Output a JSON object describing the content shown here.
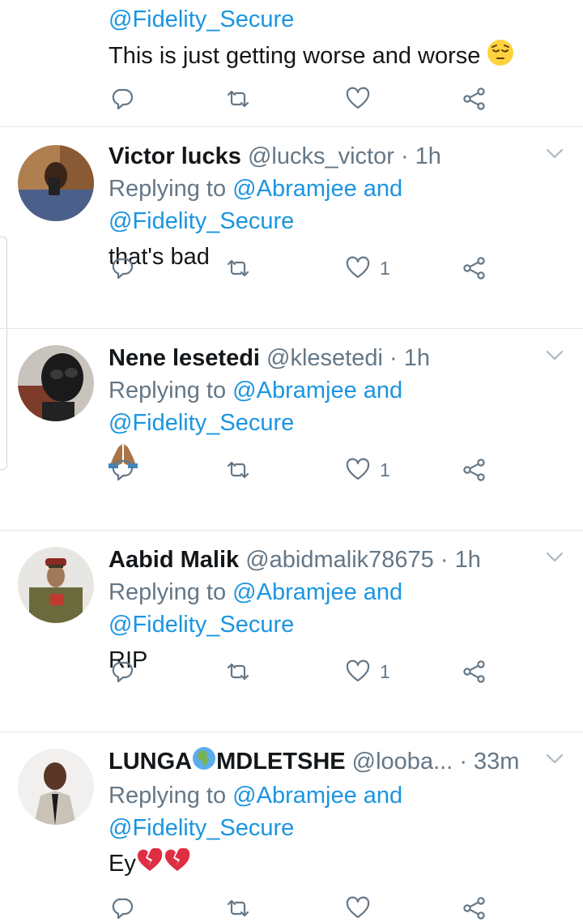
{
  "colors": {
    "accent": "#1b95e0",
    "text": "#14171a",
    "muted": "#657786",
    "divider": "#e1e8ed"
  },
  "first_tweet": {
    "mention": "@Fidelity_Secure",
    "text": "This is just getting worse and worse",
    "emoji": "pensive-face"
  },
  "replies": [
    {
      "name": "Victor lucks",
      "handle": "@lucks_victor",
      "time": "· 1h",
      "replying_prefix": "Replying to",
      "replying_mention1": "@Abramjee and",
      "replying_mention2": "@Fidelity_Secure",
      "text": "that's bad",
      "likes": "1"
    },
    {
      "name": "Nene lesetedi",
      "handle": "@klesetedi",
      "time": "· 1h",
      "replying_prefix": "Replying to",
      "replying_mention1": "@Abramjee and",
      "replying_mention2": "@Fidelity_Secure",
      "text": "",
      "emoji": "folded-hands",
      "likes": "1"
    },
    {
      "name": "Aabid Malik",
      "handle": "@abidmalik78675",
      "time": "· 1h",
      "replying_prefix": "Replying to",
      "replying_mention1": "@Abramjee and",
      "replying_mention2": "@Fidelity_Secure",
      "text": "RIP",
      "likes": "1"
    },
    {
      "name_part1": "LUNGA",
      "name_emoji": "globe-africa",
      "name_part2": "MDLETSHE",
      "handle": "@looba...",
      "time": "· 33m",
      "replying_prefix": "Replying to",
      "replying_mention1": "@Abramjee and",
      "replying_mention2": "@Fidelity_Secure",
      "text": "Ey",
      "emoji": "broken-heart"
    }
  ],
  "icons": {
    "reply": "reply-icon",
    "retweet": "retweet-icon",
    "like": "heart-icon",
    "share": "share-icon",
    "menu": "chevron-down-icon"
  }
}
